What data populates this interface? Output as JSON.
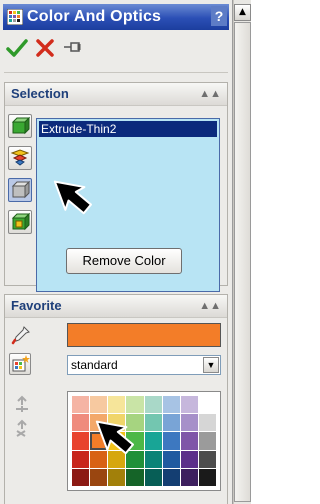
{
  "titlebar": {
    "title": "Color And Optics",
    "help_label": "?"
  },
  "actions": {
    "ok_icon": "check-icon",
    "cancel_icon": "x-icon",
    "pin_icon": "pushpin-icon"
  },
  "selection": {
    "header": "Selection",
    "buttons": [
      "select-part-icon",
      "select-face-icon",
      "select-feature-icon",
      "select-body-icon"
    ],
    "items": [
      {
        "label": "Extrude-Thin2"
      }
    ],
    "remove_label": "Remove Color"
  },
  "favorite": {
    "header": "Favorite",
    "current_color": "#f37d28",
    "palette_name": "standard",
    "palette_colors": [
      [
        "#f5b4a4",
        "#f7c9a0",
        "#f6e59a",
        "#c9e4a6",
        "#a9d8c8",
        "#a7c3e4",
        "#c6b7dc",
        "#ffffff"
      ],
      [
        "#ef8b7d",
        "#f3a86a",
        "#f0d56a",
        "#a6d480",
        "#73c6b0",
        "#79a4d6",
        "#a690c9",
        "#d6d6d6"
      ],
      [
        "#e8432e",
        "#f37d28",
        "#f2c31b",
        "#4cb847",
        "#18a596",
        "#3d78c0",
        "#7f55a8",
        "#9b9b9b"
      ],
      [
        "#c8251b",
        "#d86214",
        "#d6a70e",
        "#1f9038",
        "#0a8377",
        "#1f5aa0",
        "#5c2f8a",
        "#4d4d4d"
      ],
      [
        "#8c1a14",
        "#9a4610",
        "#a2800a",
        "#156428",
        "#075e56",
        "#143e72",
        "#3d1f5e",
        "#1a1a1a"
      ]
    ]
  }
}
